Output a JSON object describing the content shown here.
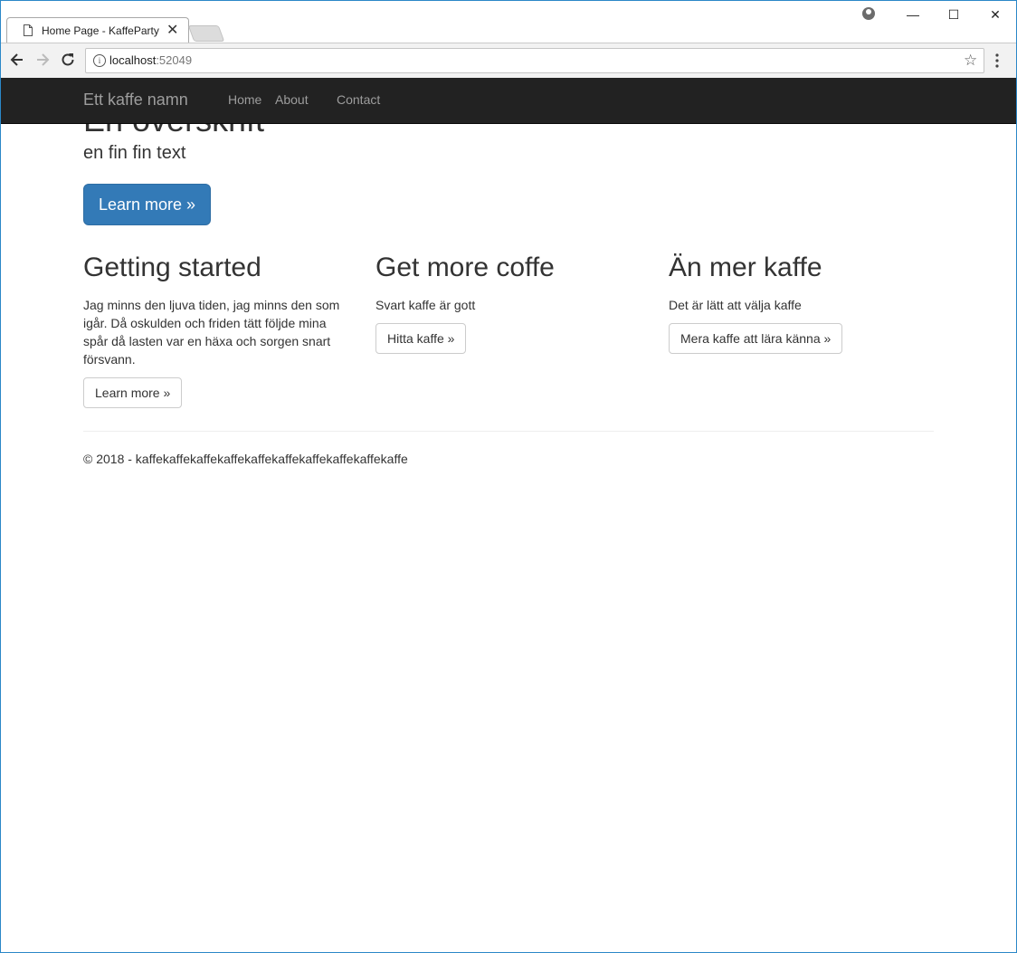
{
  "browser": {
    "tab_title": "Home Page - KaffeParty",
    "tab_close_glyph": "✕",
    "url_host": "localhost",
    "url_port": ":52049",
    "controls": {
      "minimize": "—",
      "maximize": "☐",
      "close": "✕"
    },
    "icons": [
      "page-icon",
      "profile-icon",
      "back-arrow-icon",
      "forward-arrow-icon",
      "reload-icon",
      "info-icon",
      "star-icon",
      "kebab-menu-icon"
    ]
  },
  "navbar": {
    "brand": "Ett kaffe namn",
    "links": [
      "Home",
      "About",
      "Contact"
    ]
  },
  "jumbotron": {
    "title": "En overskrift",
    "lead": "en fin fin text",
    "button": "Learn more »"
  },
  "columns": [
    {
      "heading": "Getting started",
      "text": "Jag minns den ljuva tiden, jag minns den som igår. Då oskulden och friden tätt följde mina spår då lasten var en häxa och sorgen snart försvann.",
      "button": "Learn more »"
    },
    {
      "heading": "Get more coffe",
      "text": "Svart kaffe är gott",
      "button": "Hitta kaffe »"
    },
    {
      "heading": "Än mer kaffe",
      "text": "Det är lätt att välja kaffe",
      "button": "Mera kaffe att lära känna »"
    }
  ],
  "footer": {
    "text": "© 2018 - kaffekaffekaffekaffekaffekaffekaffekaffekaffekaffe"
  },
  "colors": {
    "navbar_bg": "#222222",
    "primary": "#337ab7",
    "window_border": "#2b88c8"
  }
}
